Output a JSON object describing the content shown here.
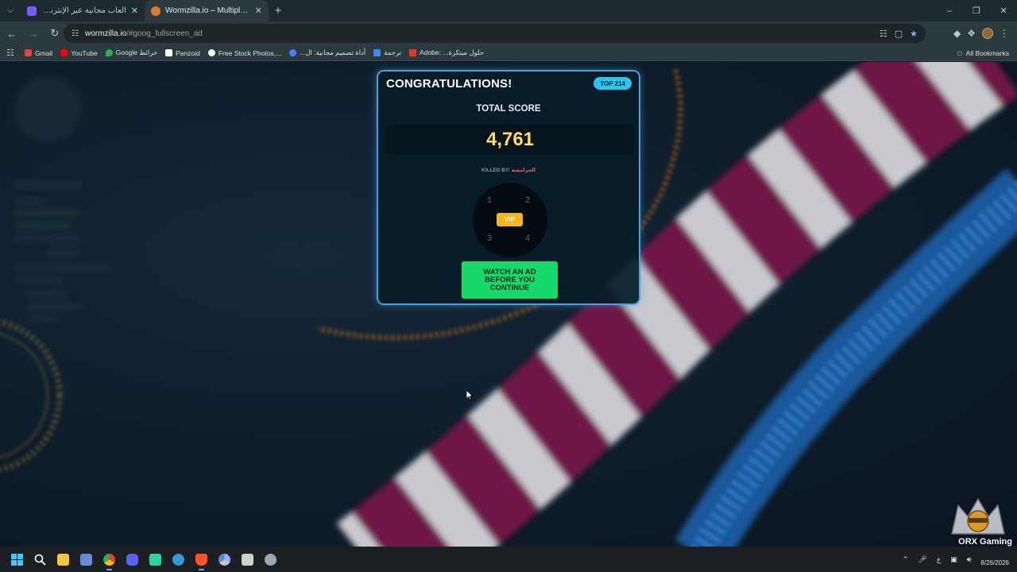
{
  "browser": {
    "tabs": [
      {
        "title": "ألعاب مجانية عبر الإنترنت على كرا",
        "active": false,
        "favicon_color": "#7b5cff"
      },
      {
        "title": "Wormzilla.io – Multiplayer Snake",
        "active": true,
        "favicon_color": "#e07a2a"
      }
    ],
    "new_tab_icon": "plus-icon",
    "url_host": "wormzilla.io",
    "url_path": "/#goog_fullscreen_ad",
    "bookmarks": [
      {
        "label": "Gmail",
        "color": "#ea4335"
      },
      {
        "label": "YouTube",
        "color": "#ff0000"
      },
      {
        "label": "خرائط Google",
        "color": "#34a853"
      },
      {
        "label": "Panzoid",
        "color": "#ffffff"
      },
      {
        "label": "Free Stock Photos,...",
        "color": "#ffffff"
      },
      {
        "label": "أداة تصميم مجانية: ال...",
        "color": "#4285f4"
      },
      {
        "label": "ترجمة",
        "color": "#4285f4"
      },
      {
        "label": "حلول مبتكرة... :Adobe",
        "color": "#e8352a"
      }
    ],
    "all_bookmarks_label": "All Bookmarks"
  },
  "game": {
    "panel": {
      "title": "CONGRATULATIONS!",
      "rank_badge": "TOP 214",
      "score_label": "TOTAL SCORE",
      "score_value": "4,761",
      "killed_by_label": "KILLED BY:",
      "killer_name": "الحرامشه",
      "wheel_numbers": [
        "1",
        "2",
        "3",
        "4"
      ],
      "vip_label": "VIP",
      "watch_button_label": "WATCH AN AD BEFORE YOU CONTINUE"
    },
    "watermark_text": "ORX Gaming"
  },
  "taskbar": {
    "icons": [
      {
        "name": "windows-start-icon",
        "color": "#4cc2ff",
        "active": false
      },
      {
        "name": "search-icon",
        "color": "#ffffff",
        "active": false
      },
      {
        "name": "file-explorer-icon",
        "color": "#f5c542",
        "active": false
      },
      {
        "name": "app-icon",
        "color": "#6a8ad8",
        "active": false
      },
      {
        "name": "chrome-icon",
        "color": "#34a853",
        "active": true
      },
      {
        "name": "discord-icon",
        "color": "#5865f2",
        "active": false
      },
      {
        "name": "game-launcher-icon",
        "color": "#2fd3a0",
        "active": false
      },
      {
        "name": "browser-icon",
        "color": "#3a9ad8",
        "active": false
      },
      {
        "name": "brave-icon",
        "color": "#fb542b",
        "active": true
      },
      {
        "name": "chrome-dev-icon",
        "color": "#8ab4f8",
        "active": false
      },
      {
        "name": "store-icon",
        "color": "#d0d0d0",
        "active": false
      },
      {
        "name": "settings-icon",
        "color": "#9aa7b8",
        "active": false
      }
    ],
    "tray": {
      "language": "ع",
      "date": "8/26/2026"
    }
  }
}
